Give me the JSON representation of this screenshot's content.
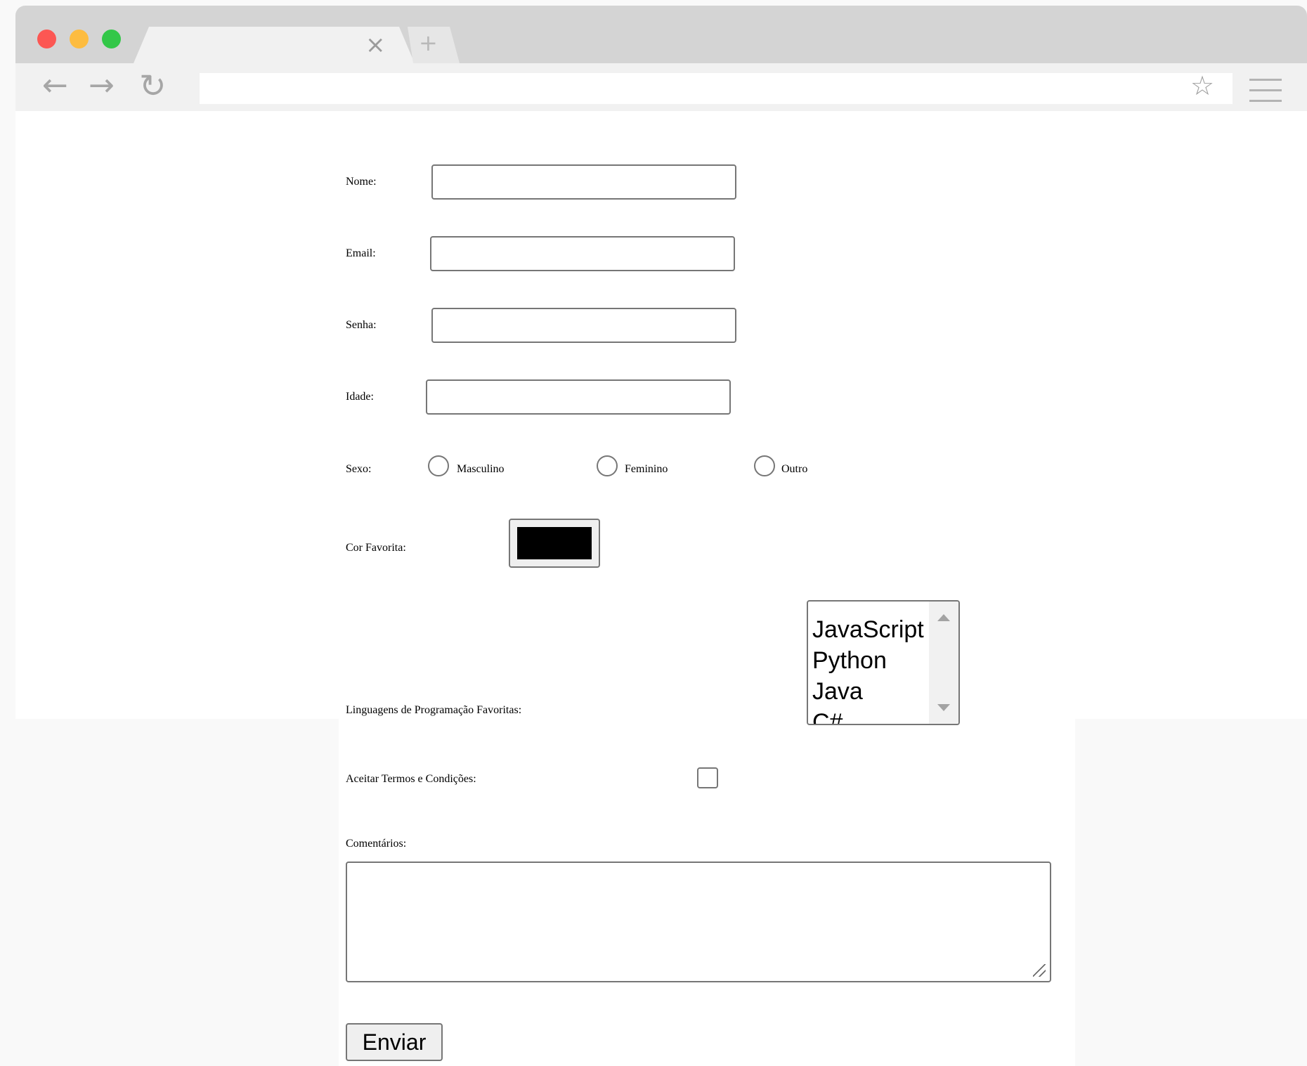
{
  "browser": {
    "tab_title": "",
    "tab_close_glyph": "×",
    "new_tab_glyph": "+",
    "back_glyph": "←",
    "forward_glyph": "→",
    "reload_glyph": "↻",
    "address_value": "",
    "bookmark_glyph": "☆"
  },
  "form": {
    "name_label": "Nome:",
    "name_value": "",
    "email_label": "Email:",
    "email_value": "",
    "password_label": "Senha:",
    "password_value": "",
    "age_label": "Idade:",
    "age_value": "",
    "gender_label": "Sexo:",
    "gender_options": [
      "Masculino",
      "Feminino",
      "Outro"
    ],
    "color_label": "Cor Favorita:",
    "color_value": "#000000",
    "languages_label": "Linguagens de Programação Favoritas:",
    "languages_options": [
      "JavaScript",
      "Python",
      "Java",
      "C#"
    ],
    "terms_label": "Aceitar Termos e Condições:",
    "terms_checked": false,
    "comments_label": "Comentários:",
    "comments_value": "",
    "submit_label": "Enviar"
  },
  "colors": {
    "close_dot": "#fc5753",
    "minimize_dot": "#fdbc40",
    "maximize_dot": "#33c748"
  }
}
